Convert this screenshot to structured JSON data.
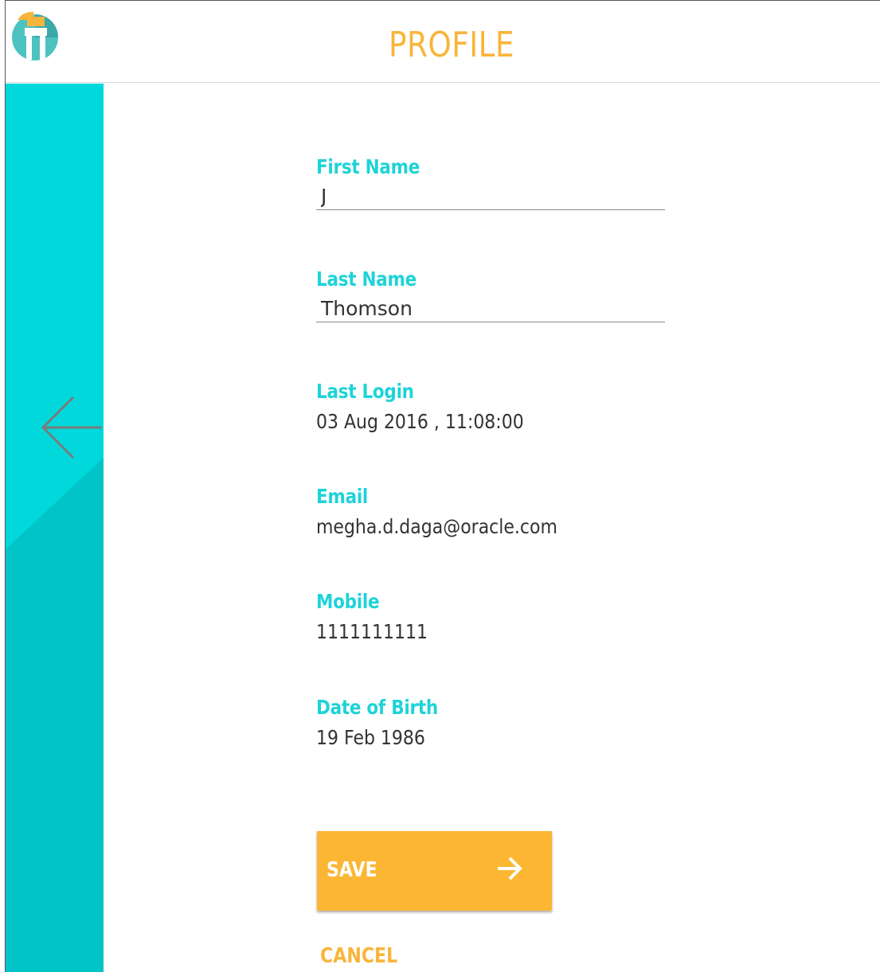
{
  "header": {
    "title": "PROFILE",
    "logo_icon": "app-logo-icon"
  },
  "sidebar": {
    "back_icon": "arrow-left-icon"
  },
  "form": {
    "first_name": {
      "label": "First Name",
      "value": "J"
    },
    "last_name": {
      "label": "Last Name",
      "value": "Thomson"
    },
    "last_login": {
      "label": "Last Login",
      "value": "03 Aug 2016 , 11:08:00"
    },
    "email": {
      "label": "Email",
      "value": "megha.d.daga@oracle.com"
    },
    "mobile": {
      "label": "Mobile",
      "value": "1111111111"
    },
    "date_of_birth": {
      "label": "Date of Birth",
      "value": "19 Feb 1986"
    }
  },
  "actions": {
    "save_label": "SAVE",
    "save_icon": "arrow-right-icon",
    "cancel_label": "CANCEL"
  },
  "colors": {
    "accent": "#f8b53b",
    "teal": "#00c4c8",
    "label": "#1ed3d8"
  }
}
